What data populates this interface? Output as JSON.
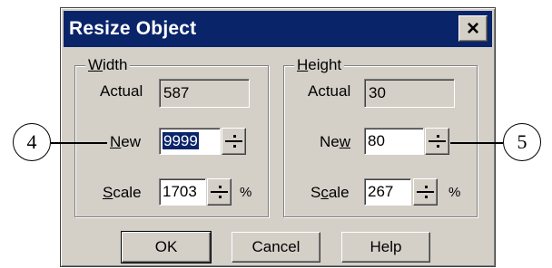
{
  "dialog": {
    "title": "Resize Object",
    "close_glyph": "×"
  },
  "width_group": {
    "legend_u": "W",
    "legend_rest": "idth",
    "actual_label": "Actual",
    "actual_value": "587",
    "new_label_u": "N",
    "new_label_rest": "ew",
    "new_value": "9999",
    "scale_label_u": "S",
    "scale_label_rest": "cale",
    "scale_value": "1703",
    "scale_unit": "%"
  },
  "height_group": {
    "legend_u": "H",
    "legend_rest": "eight",
    "actual_label": "Actual",
    "actual_value": "30",
    "new_label_pre": "Ne",
    "new_label_u": "w",
    "new_value": "80",
    "scale_label_pre": "S",
    "scale_label_u": "c",
    "scale_label_rest": "ale",
    "scale_value": "267",
    "scale_unit": "%"
  },
  "buttons": {
    "ok": "OK",
    "cancel": "Cancel",
    "help": "Help"
  },
  "callouts": {
    "left": "4",
    "right": "5"
  }
}
